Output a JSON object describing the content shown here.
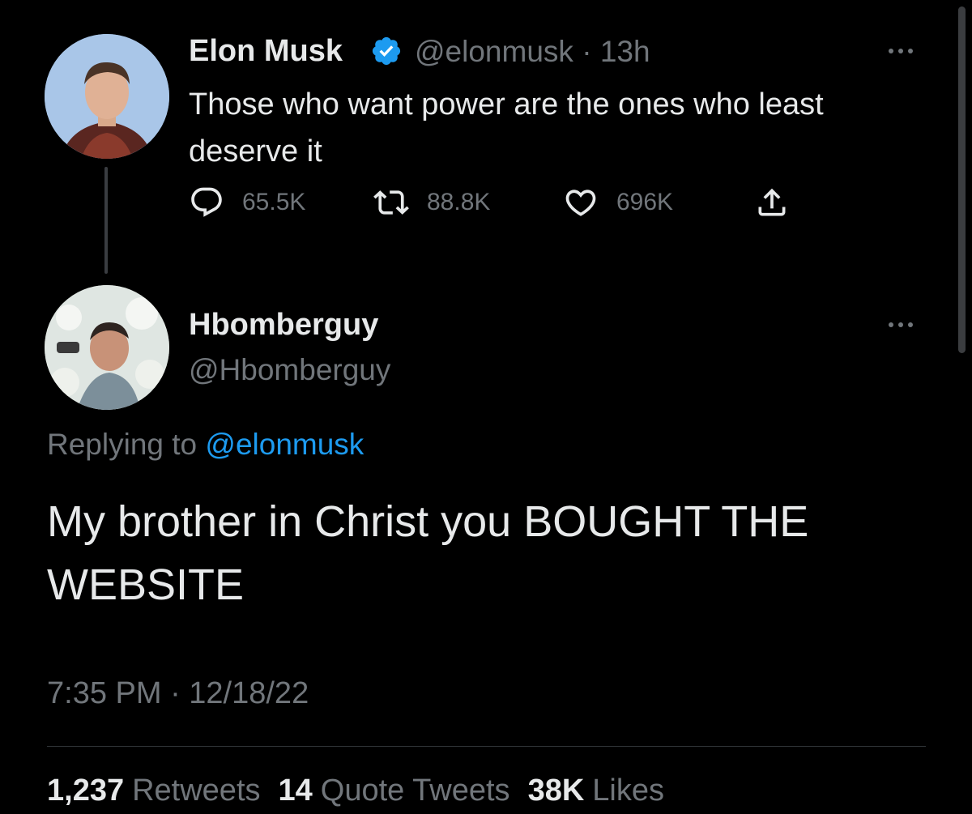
{
  "original_tweet": {
    "author_name": "Elon Musk",
    "handle": "@elonmusk",
    "time_sep": "·",
    "time": "13h",
    "text": "Those who want power are the ones who least deserve it",
    "actions": {
      "replies": "65.5K",
      "retweets": "88.8K",
      "likes": "696K"
    }
  },
  "reply_tweet": {
    "author_name": "Hbomberguy",
    "handle": "@Hbomberguy",
    "replying_prefix": "Replying to",
    "replying_mention": "@elonmusk",
    "text": "My brother in Christ you BOUGHT THE WEBSITE",
    "timestamp": "7:35 PM · 12/18/22",
    "stats": {
      "retweets_count": "1,237",
      "retweets_label": "Retweets",
      "quotes_count": "14",
      "quotes_label": "Quote Tweets",
      "likes_count": "38K",
      "likes_label": "Likes"
    }
  },
  "colors": {
    "background": "#000000",
    "text": "#e7e9ea",
    "muted": "#71767b",
    "accent": "#1d9bf0"
  },
  "icons": [
    "verified-badge-icon",
    "more-icon",
    "reply-icon",
    "retweet-icon",
    "like-icon",
    "share-icon"
  ]
}
